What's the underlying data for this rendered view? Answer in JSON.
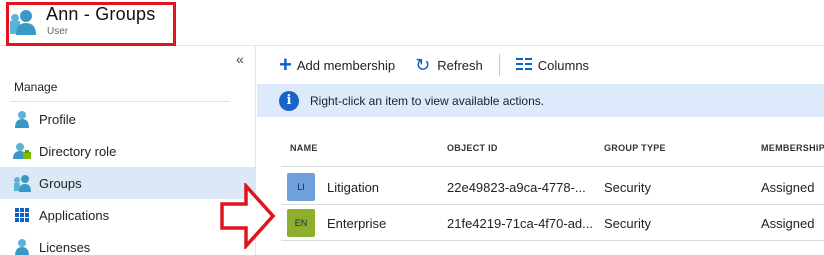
{
  "header": {
    "title": "Ann - Groups",
    "subtitle": "User",
    "icon": "user-icon"
  },
  "sidebar": {
    "collapse_glyph": "«",
    "section_label": "Manage",
    "items": [
      {
        "label": "Profile",
        "icon": "user-icon",
        "active": false
      },
      {
        "label": "Directory role",
        "icon": "directory-role-icon",
        "active": false
      },
      {
        "label": "Groups",
        "icon": "groups-icon",
        "active": true
      },
      {
        "label": "Applications",
        "icon": "applications-grid-icon",
        "active": false
      },
      {
        "label": "Licenses",
        "icon": "licenses-icon",
        "active": false
      }
    ]
  },
  "toolbar": {
    "add_membership": "Add membership",
    "refresh": "Refresh",
    "columns": "Columns"
  },
  "info": {
    "text": "Right-click an item to view available actions."
  },
  "table": {
    "columns": [
      "NAME",
      "OBJECT ID",
      "GROUP TYPE",
      "MEMBERSHIP"
    ],
    "rows": [
      {
        "initials": "LI",
        "name": "Litigation",
        "object_id": "22e49823-a9ca-4778-...",
        "group_type": "Security",
        "membership": "Assigned",
        "badge_color": "#6fa0db"
      },
      {
        "initials": "EN",
        "name": "Enterprise",
        "object_id": "21fe4219-71ca-4f70-ad...",
        "group_type": "Security",
        "membership": "Assigned",
        "badge_color": "#8eaf2e"
      }
    ]
  },
  "colors": {
    "accent": "#0a62c9",
    "highlight_border": "#e0141e",
    "selected_nav": "#dbe9f7",
    "info_bar": "#dceafb"
  }
}
